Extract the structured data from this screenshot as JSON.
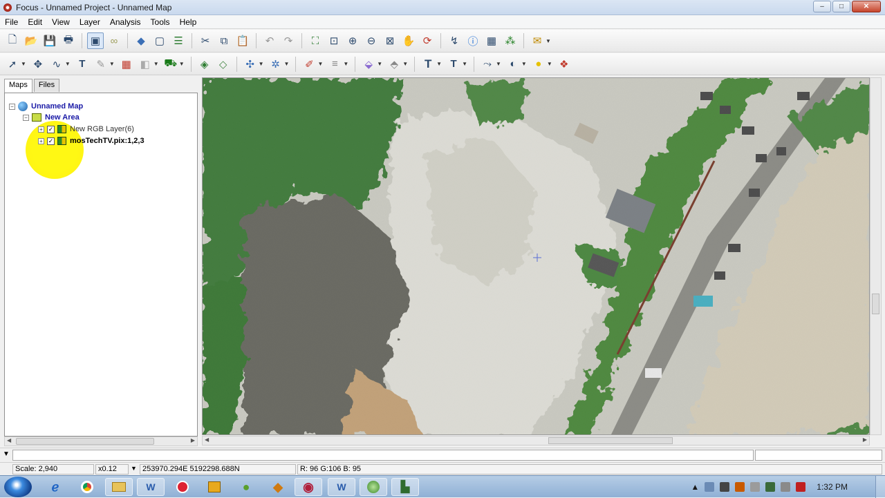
{
  "window": {
    "title": "Focus - Unnamed Project - Unnamed Map",
    "minimize": "–",
    "maximize": "□",
    "close": "✕"
  },
  "menu": [
    "File",
    "Edit",
    "View",
    "Layer",
    "Analysis",
    "Tools",
    "Help"
  ],
  "toolbar1_icons": [
    "new-icon",
    "open-icon",
    "save-icon",
    "print-icon",
    "view-area-icon",
    "link-icon",
    "eraser-icon",
    "frame-icon",
    "layers-icon",
    "cut-icon",
    "copy-icon",
    "paste-icon",
    "undo-icon",
    "redo-icon",
    "zoom-extent-icon",
    "zoom-box-icon",
    "zoom-in-icon",
    "zoom-out-icon",
    "zoom-fit-icon",
    "pan-icon",
    "refresh-icon",
    "pixel-query-icon",
    "info-icon",
    "table-icon",
    "histogram-icon",
    "chart-icon"
  ],
  "toolbar2_icons": [
    "select-arrow-icon",
    "node-edit-icon",
    "polyline-icon",
    "text-icon",
    "brush-icon",
    "grid-icon",
    "fill-icon",
    "paint-bucket-icon",
    "layer-stack-icon",
    "layer-group-icon",
    "vector-icon",
    "vector-edit-icon",
    "line-color-icon",
    "line-style-icon",
    "fill-color-icon",
    "paint-icon",
    "font-icon",
    "text-format-icon",
    "measure-icon",
    "contrast-icon",
    "light-icon",
    "color-wheel-icon"
  ],
  "left_panel": {
    "tabs": [
      "Maps",
      "Files"
    ],
    "tree": {
      "map": "Unnamed Map",
      "area": "New Area",
      "layers": [
        "New RGB Layer(6)",
        "mosTechTV.pix:1,2,3"
      ]
    }
  },
  "status": {
    "scale": "Scale: 2,940",
    "zoom": "x0.12",
    "coords": "253970.294E 5192298.688N",
    "pixel": "R: 96 G:106 B: 95"
  },
  "taskbar": {
    "apps": [
      "ie-icon",
      "chrome-icon",
      "explorer-icon",
      "word-doc-icon",
      "media-icon",
      "outlook-icon",
      "paint-icon",
      "webcam-icon",
      "word-icon",
      "focus-icon",
      "plugin-icon"
    ],
    "clock": "1:32 PM"
  },
  "colors": {
    "titlebar": "#dbe6f4",
    "highlight": "#fff700",
    "taskbar": "#9db9dc"
  }
}
